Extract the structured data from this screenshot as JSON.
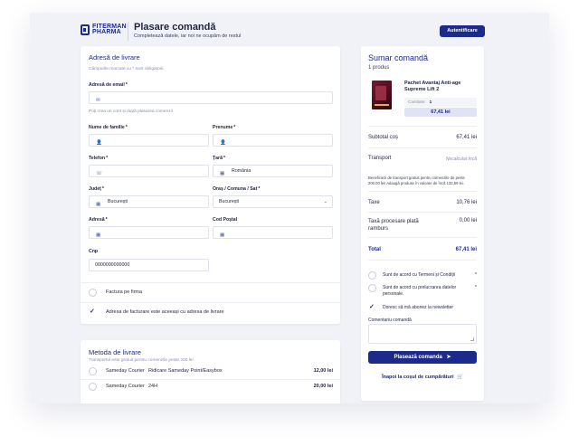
{
  "header": {
    "logo_line1": "FITERMAN",
    "logo_line2": "PHARMA",
    "title": "Plasare comandă",
    "subtitle": "Completează datele, iar noi ne ocupăm de restul",
    "auth_button": "Autentificare"
  },
  "address": {
    "section_title": "Adresă de livrare",
    "required_hint": "Câmpurile marcate cu * sunt obligatorii.",
    "email_label": "Adresă de email",
    "email_value": "",
    "account_hint": "Poți crea un cont și după plasarea comenzii",
    "lastname_label": "Nume de familie",
    "lastname_value": "",
    "firstname_label": "Prenume",
    "firstname_value": "",
    "phone_label": "Telefon",
    "phone_value": "",
    "country_label": "Țară",
    "country_value": "România",
    "county_label": "Județ",
    "county_value": "București",
    "city_label": "Oraș / Comuna / Sat",
    "city_value": "București",
    "street_label": "Adresă",
    "street_value": "",
    "postal_label": "Cod Poștal",
    "postal_value": "",
    "cnp_label": "Cnp",
    "cnp_value": "0000000000000",
    "req_mark": "*",
    "company_invoice": "Factura pe firma",
    "same_billing": "Adresa de facturare este aceeași cu adresa de livrare"
  },
  "shipping": {
    "section_title": "Metoda de livrare",
    "hint": "Transportul este gratuit pentru comenzile peste 200 lei",
    "options": [
      {
        "name": "Sameday Courier",
        "desc": "Ridicare Sameday Point/Easybox",
        "price": "12,00 lei"
      },
      {
        "name": "Sameday Courier",
        "desc": "24H",
        "price": "20,00 lei"
      }
    ]
  },
  "summary": {
    "title": "Sumar comandă",
    "count": "1 produs",
    "product_name": "Pachet Avantaj Anti-age Supreme Lift 2",
    "qty_label": "Cantitate:",
    "qty_value": "1",
    "product_price": "67,41 lei",
    "subtotal_label": "Subtotal coș",
    "subtotal_value": "67,41 lei",
    "transport_label": "Transport",
    "transport_value": "Necalculat încă",
    "transport_note": "Beneficiezi de transport gratuit pentru comenzile de peste 200.00 lei! Adaugă produse în valoare de încă 132,59 lei.",
    "tax_label": "Taxe",
    "tax_value": "10,76 lei",
    "cod_label": "Taxă procesare plată ramburs",
    "cod_value": "0,00 lei",
    "total_label": "Total",
    "total_value": "67,41 lei",
    "agree_terms": "Sunt de acord cu Termeni și Condiții",
    "agree_data": "Sunt de acord cu prelucrarea datelor personale.",
    "newsletter": "Doresc să mă abonez la newsletter",
    "comment_label": "Comentariu comandă",
    "order_button": "Plasează comanda",
    "back_link": "Înapoi la coșul de cumpărături"
  },
  "colors": {
    "brand": "#1c2a8c",
    "page_bg": "#f1f2f7"
  },
  "icons": {
    "email": "envelope-icon",
    "person": "person-icon",
    "phone": "phone-icon",
    "building": "building-icon",
    "send": "send-icon",
    "cart": "cart-icon"
  }
}
